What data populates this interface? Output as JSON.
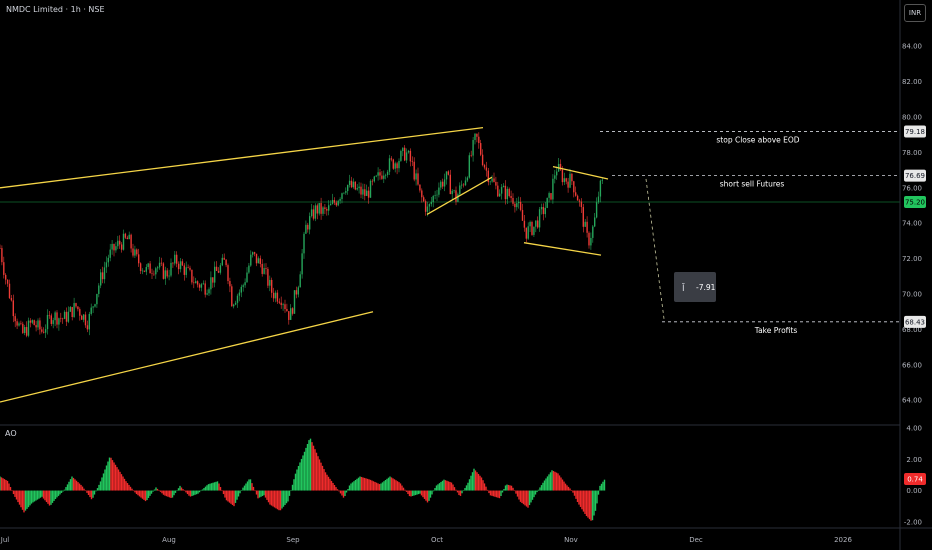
{
  "header": {
    "title": "NMDC Limited · 1h · NSE",
    "currency": "INR"
  },
  "indicator": {
    "name": "AO"
  },
  "colors": {
    "bull": "#26a65b",
    "bear": "#ef3b36",
    "trendline": "#f5d547",
    "hline": "#d1d4dc",
    "last_price_bg": "#22c55e",
    "ao_up": "#22c55e",
    "ao_down": "#ef2b2b"
  },
  "chart_data": [
    {
      "type": "candlestick",
      "title": "NMDC Limited · 1h · NSE",
      "y_ticks": [
        "64.00",
        "66.00",
        "68.00",
        "70.00",
        "72.00",
        "74.00",
        "76.00",
        "78.00",
        "80.00",
        "82.00",
        "84.00"
      ],
      "ylim": [
        62.6,
        85.2
      ],
      "x_ticks": [
        "Jul",
        "Aug",
        "Sep",
        "Oct",
        "Nov",
        "Dec",
        "2026"
      ],
      "last_price": 75.2,
      "price_labels": [
        {
          "value": 79.18,
          "text": "79.18"
        },
        {
          "value": 76.69,
          "text": "76.69"
        },
        {
          "value": 68.43,
          "text": "68.43"
        }
      ],
      "price_path": [
        [
          0,
          72.6
        ],
        [
          6,
          70.8
        ],
        [
          14,
          69.0
        ],
        [
          22,
          67.7
        ],
        [
          32,
          68.4
        ],
        [
          42,
          67.9
        ],
        [
          52,
          68.8
        ],
        [
          64,
          68.6
        ],
        [
          76,
          69.3
        ],
        [
          88,
          68.4
        ],
        [
          98,
          70.4
        ],
        [
          108,
          72.1
        ],
        [
          118,
          72.8
        ],
        [
          128,
          73.1
        ],
        [
          136,
          72.0
        ],
        [
          146,
          71.3
        ],
        [
          156,
          71.6
        ],
        [
          166,
          71.1
        ],
        [
          176,
          71.9
        ],
        [
          186,
          71.3
        ],
        [
          196,
          70.6
        ],
        [
          206,
          70.4
        ],
        [
          216,
          71.2
        ],
        [
          226,
          71.9
        ],
        [
          232,
          69.6
        ],
        [
          242,
          70.3
        ],
        [
          252,
          72.2
        ],
        [
          262,
          71.6
        ],
        [
          272,
          70.1
        ],
        [
          282,
          69.8
        ],
        [
          290,
          68.7
        ],
        [
          298,
          70.6
        ],
        [
          306,
          73.8
        ],
        [
          316,
          74.8
        ],
        [
          326,
          74.6
        ],
        [
          336,
          75.3
        ],
        [
          346,
          76.2
        ],
        [
          356,
          75.9
        ],
        [
          366,
          75.6
        ],
        [
          376,
          76.4
        ],
        [
          386,
          77.2
        ],
        [
          396,
          77.5
        ],
        [
          406,
          78.0
        ],
        [
          412,
          77.3
        ],
        [
          420,
          75.6
        ],
        [
          428,
          74.7
        ],
        [
          436,
          75.9
        ],
        [
          446,
          76.6
        ],
        [
          456,
          75.4
        ],
        [
          466,
          76.7
        ],
        [
          476,
          78.9
        ],
        [
          486,
          77.0
        ],
        [
          496,
          76.0
        ],
        [
          506,
          75.7
        ],
        [
          516,
          75.3
        ],
        [
          526,
          73.5
        ],
        [
          534,
          73.8
        ],
        [
          542,
          74.6
        ],
        [
          550,
          75.4
        ],
        [
          556,
          77.2
        ],
        [
          564,
          76.5
        ],
        [
          572,
          76.4
        ],
        [
          578,
          75.4
        ],
        [
          582,
          74.5
        ],
        [
          588,
          72.9
        ],
        [
          594,
          73.9
        ],
        [
          598,
          75.5
        ],
        [
          602,
          76.4
        ],
        [
          604,
          75.2
        ]
      ],
      "channel_upper": [
        [
          0,
          76.0
        ],
        [
          483,
          79.4
        ]
      ],
      "channel_lower": [
        [
          0,
          63.9
        ],
        [
          373,
          69.0
        ]
      ],
      "flag_lower": [
        [
          427,
          74.5
        ],
        [
          492,
          76.6
        ]
      ],
      "wedge_upper": [
        [
          553,
          77.2
        ],
        [
          608,
          76.5
        ]
      ],
      "wedge_lower": [
        [
          524,
          72.9
        ],
        [
          601,
          72.2
        ]
      ],
      "target_path": [
        [
          646,
          76.5
        ],
        [
          664,
          68.6
        ]
      ],
      "levels": [
        {
          "value": 79.18,
          "label": "stop Close above EOD"
        },
        {
          "value": 76.69,
          "label": "short sell Futures"
        },
        {
          "value": 68.43,
          "label": "Take Profits"
        }
      ],
      "measure_label": "-7.91",
      "measure_icon": "price-range-icon"
    },
    {
      "type": "bar",
      "title": "AO",
      "y_ticks": [
        "-2.00",
        "0.00",
        "2.00",
        "4.00"
      ],
      "ylim": [
        -2.4,
        4.2
      ],
      "last_value": 0.74,
      "last_value_text": "0.74",
      "zero_text": "0.00",
      "keyframes": [
        [
          0,
          0.9
        ],
        [
          8,
          0.6
        ],
        [
          14,
          -0.3
        ],
        [
          24,
          -1.4
        ],
        [
          32,
          -0.8
        ],
        [
          42,
          -0.4
        ],
        [
          50,
          -1.0
        ],
        [
          56,
          -0.5
        ],
        [
          64,
          0.0
        ],
        [
          72,
          0.9
        ],
        [
          82,
          0.3
        ],
        [
          92,
          -0.6
        ],
        [
          100,
          0.5
        ],
        [
          110,
          2.2
        ],
        [
          118,
          1.4
        ],
        [
          126,
          0.6
        ],
        [
          136,
          -0.2
        ],
        [
          146,
          -0.7
        ],
        [
          156,
          0.2
        ],
        [
          164,
          -0.3
        ],
        [
          172,
          -0.5
        ],
        [
          180,
          0.3
        ],
        [
          190,
          -0.4
        ],
        [
          198,
          -0.2
        ],
        [
          208,
          0.4
        ],
        [
          218,
          0.6
        ],
        [
          226,
          -0.6
        ],
        [
          234,
          -1.0
        ],
        [
          242,
          0.1
        ],
        [
          250,
          0.8
        ],
        [
          258,
          -0.5
        ],
        [
          264,
          -0.3
        ],
        [
          270,
          -0.9
        ],
        [
          280,
          -1.3
        ],
        [
          288,
          -0.7
        ],
        [
          296,
          1.2
        ],
        [
          304,
          2.4
        ],
        [
          310,
          3.4
        ],
        [
          318,
          2.2
        ],
        [
          326,
          1.1
        ],
        [
          334,
          0.4
        ],
        [
          344,
          -0.5
        ],
        [
          350,
          0.4
        ],
        [
          360,
          0.9
        ],
        [
          370,
          0.7
        ],
        [
          380,
          0.4
        ],
        [
          390,
          0.9
        ],
        [
          400,
          0.5
        ],
        [
          410,
          -0.4
        ],
        [
          420,
          -0.2
        ],
        [
          428,
          -0.8
        ],
        [
          436,
          0.3
        ],
        [
          444,
          0.7
        ],
        [
          452,
          0.5
        ],
        [
          460,
          -0.4
        ],
        [
          468,
          0.5
        ],
        [
          474,
          1.4
        ],
        [
          482,
          0.8
        ],
        [
          490,
          -0.3
        ],
        [
          500,
          -0.5
        ],
        [
          506,
          0.4
        ],
        [
          512,
          0.3
        ],
        [
          520,
          -0.7
        ],
        [
          528,
          -1.1
        ],
        [
          536,
          -0.2
        ],
        [
          544,
          0.6
        ],
        [
          552,
          1.3
        ],
        [
          558,
          1.1
        ],
        [
          566,
          0.4
        ],
        [
          572,
          0.0
        ],
        [
          578,
          -0.8
        ],
        [
          586,
          -1.6
        ],
        [
          592,
          -2.0
        ],
        [
          596,
          -1.2
        ],
        [
          600,
          0.3
        ],
        [
          605,
          0.74
        ]
      ]
    }
  ]
}
